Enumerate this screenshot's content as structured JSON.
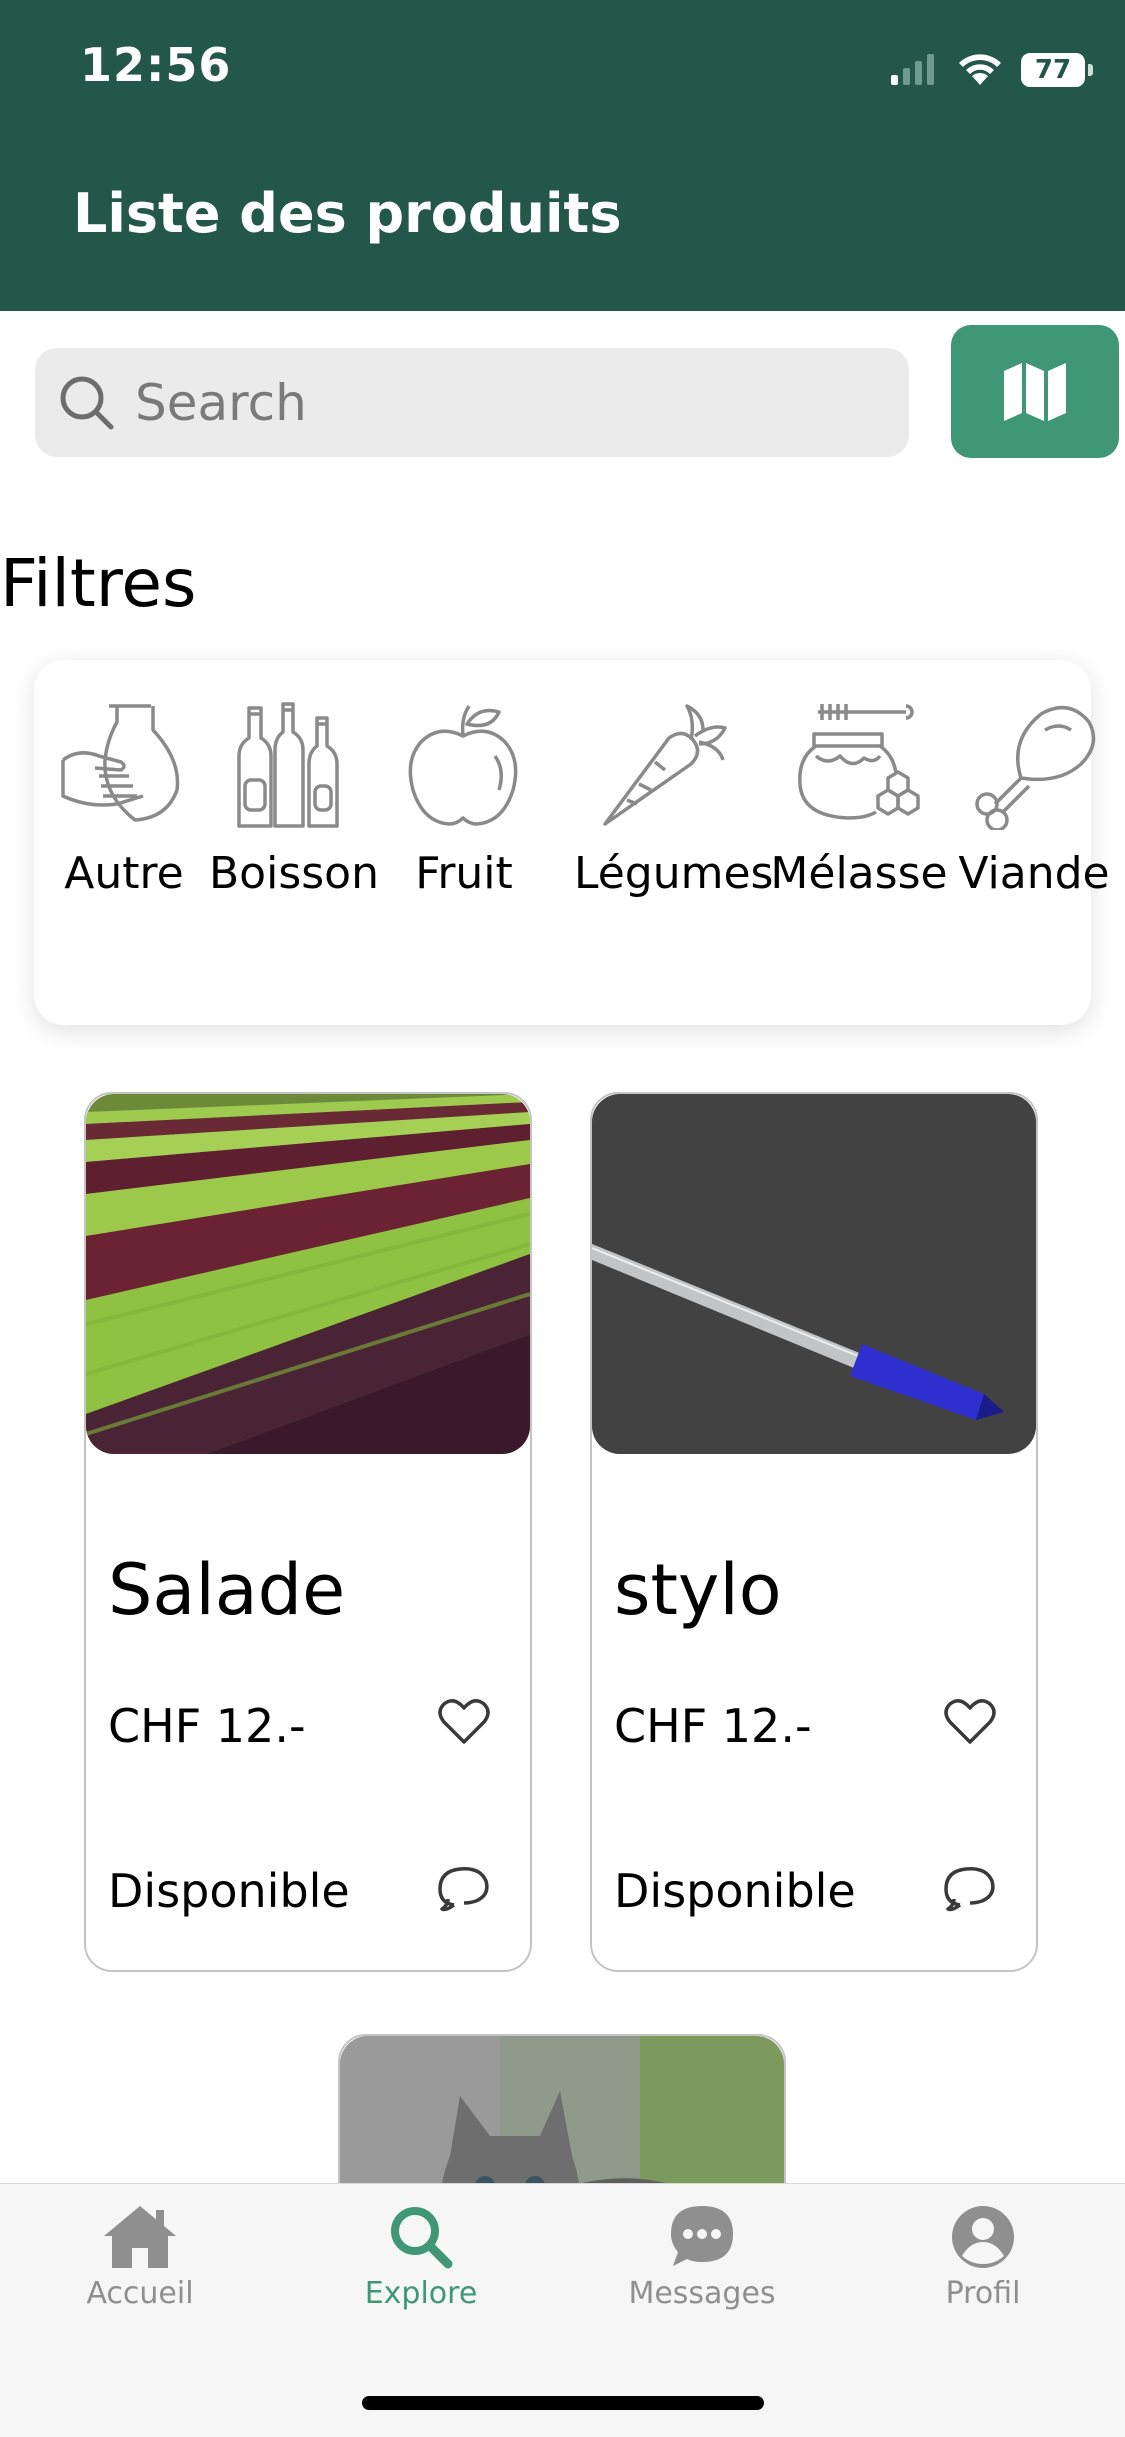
{
  "status_bar": {
    "time": "12:56",
    "battery": "77"
  },
  "header": {
    "title": "Liste des produits"
  },
  "search": {
    "placeholder": "Search"
  },
  "filters": {
    "title": "Filtres",
    "items": [
      {
        "label": "Autre",
        "icon": "hand-jug-icon"
      },
      {
        "label": "Boisson",
        "icon": "bottles-icon"
      },
      {
        "label": "Fruit",
        "icon": "apple-icon"
      },
      {
        "label": "Légumes",
        "icon": "carrot-icon"
      },
      {
        "label": "Mélasse",
        "icon": "honey-jar-icon"
      },
      {
        "label": "Viande",
        "icon": "chicken-leg-icon"
      }
    ]
  },
  "products": [
    {
      "name": "Salade",
      "price": "CHF 12.-",
      "status": "Disponible",
      "image": "lettuce-field-photo"
    },
    {
      "name": "stylo",
      "price": "CHF 12.-",
      "status": "Disponible",
      "image": "blue-pen-photo"
    },
    {
      "image": "kitten-photo"
    }
  ],
  "tabbar": {
    "items": [
      {
        "label": "Accueil",
        "icon": "home-icon"
      },
      {
        "label": "Explore",
        "icon": "search-icon",
        "active": true
      },
      {
        "label": "Messages",
        "icon": "chat-bubble-icon"
      },
      {
        "label": "Profil",
        "icon": "user-icon"
      }
    ]
  },
  "colors": {
    "header": "#22574a",
    "accent": "#3f9778",
    "inactive": "#8f8f8f"
  }
}
